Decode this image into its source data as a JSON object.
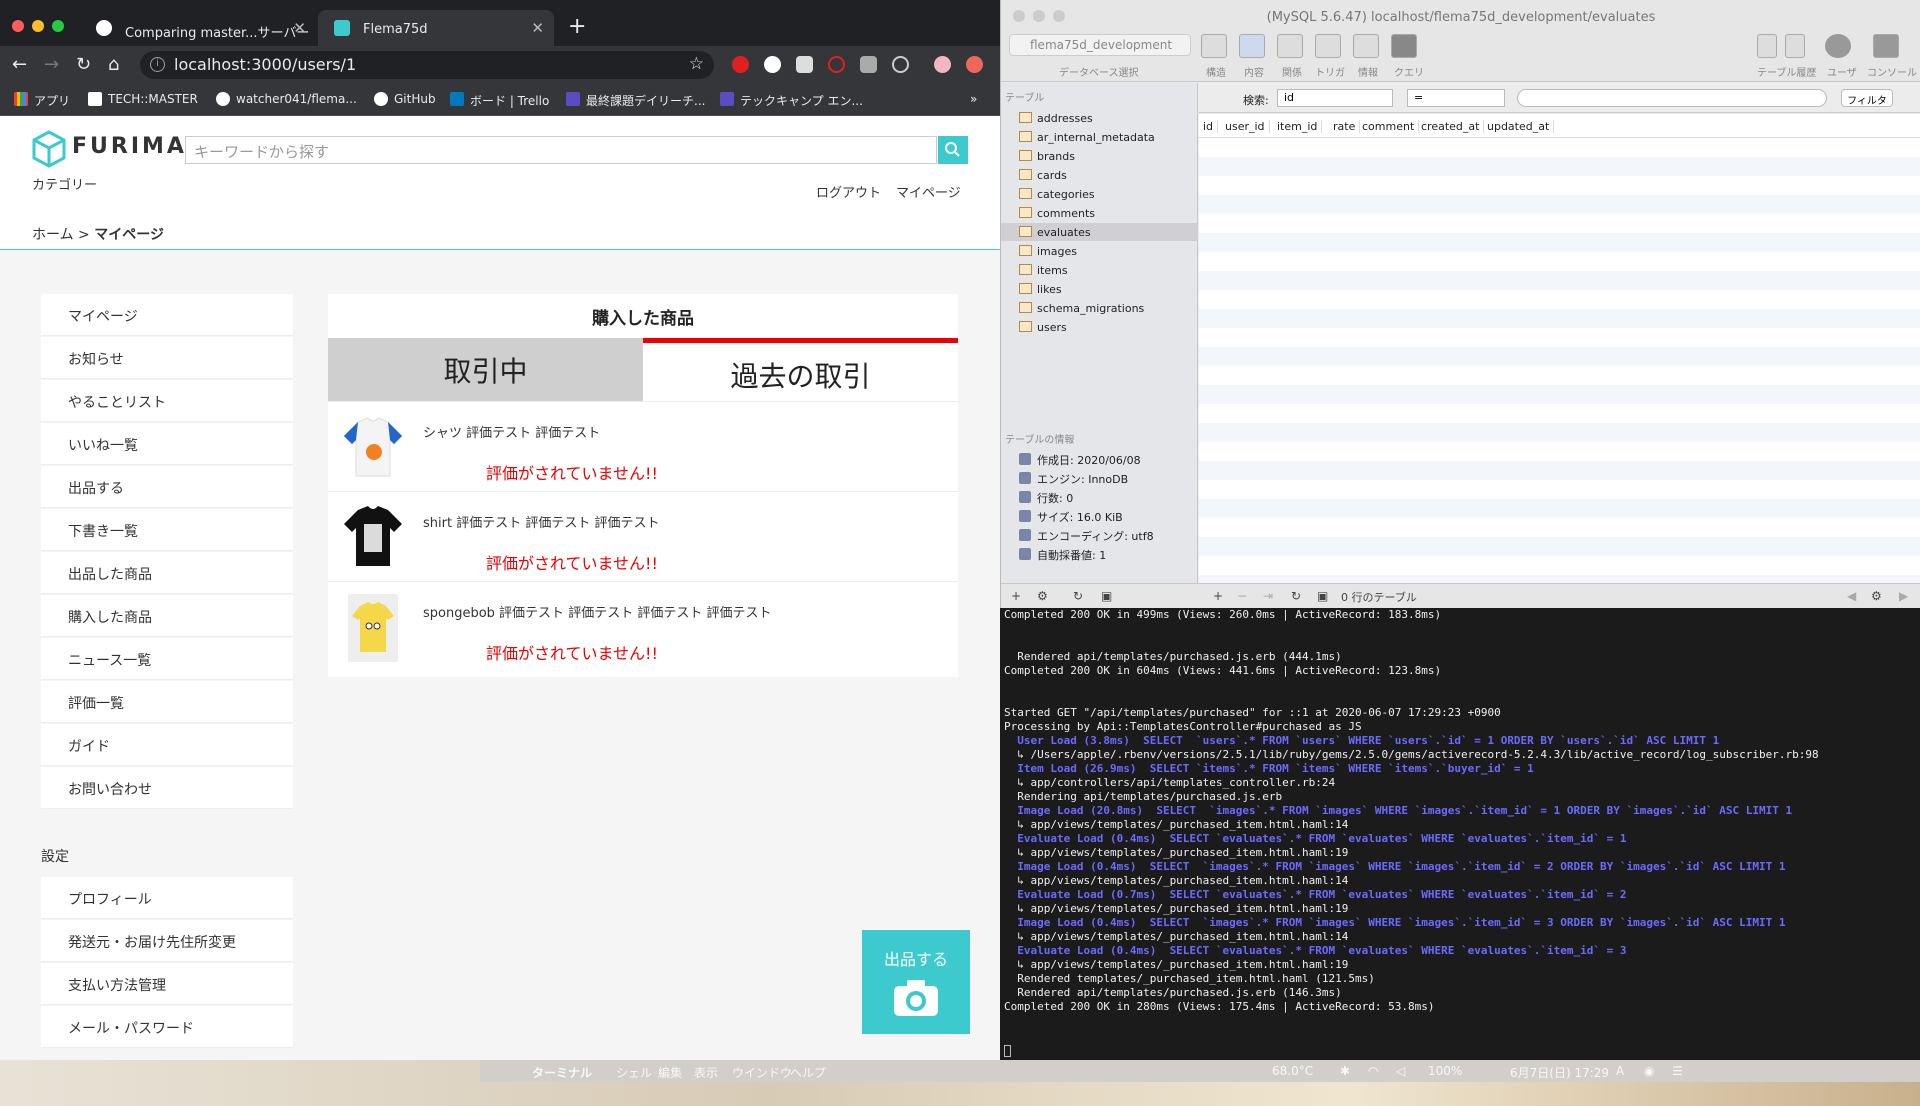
{
  "browser": {
    "tabs": [
      {
        "title": "Comparing master...サーバー"
      },
      {
        "title": "Flema75d"
      }
    ],
    "url": "localhost:3000/users/1",
    "bookmarks": [
      "アプリ",
      "TECH::MASTER",
      "watcher041/flema...",
      "GitHub",
      "ボード | Trello",
      "最終課題デイリーチ...",
      "テックキャンプ エン..."
    ]
  },
  "site": {
    "logo": "FURIMA",
    "search_placeholder": "キーワードから探す",
    "category": "カテゴリー",
    "logout": "ログアウト",
    "mypage": "マイページ",
    "breadcrumb": {
      "home": "ホーム",
      "sep": ">",
      "current": "マイページ"
    },
    "menu": [
      "マイページ",
      "お知らせ",
      "やることリスト",
      "いいね一覧",
      "出品する",
      "下書き一覧",
      "出品した商品",
      "購入した商品",
      "ニュース一覧",
      "評価一覧",
      "ガイド",
      "お問い合わせ"
    ],
    "settings_heading": "設定",
    "settings": [
      "プロフィール",
      "発送元・お届け先住所変更",
      "支払い方法管理",
      "メール・パスワード"
    ],
    "content_title": "購入した商品",
    "tab_in_progress": "取引中",
    "tab_past": "過去の取引",
    "items": [
      {
        "name": "シャツ 評価テスト 評価テスト",
        "status": "評価がされていません!!"
      },
      {
        "name": "shirt 評価テスト 評価テスト 評価テスト",
        "status": "評価がされていません!!"
      },
      {
        "name": "spongebob 評価テスト 評価テスト 評価テスト 評価テスト",
        "status": "評価がされていません!!"
      }
    ],
    "sell_button": "出品する"
  },
  "sequel": {
    "title": "(MySQL 5.6.47) localhost/flema75d_development/evaluates",
    "database": "flema75d_development",
    "database_label": "データベース選択",
    "toolbar": [
      "構造",
      "内容",
      "関係",
      "トリガ",
      "情報",
      "クエリ"
    ],
    "toolbar_right": [
      "テーブル履歴",
      "ユーザ",
      "コンソール"
    ],
    "tables_heading": "テーブル",
    "tables": [
      "addresses",
      "ar_internal_metadata",
      "brands",
      "cards",
      "categories",
      "comments",
      "evaluates",
      "images",
      "items",
      "likes",
      "schema_migrations",
      "users"
    ],
    "selected_table": "evaluates",
    "filter": {
      "label": "検索:",
      "field": "id",
      "op": "=",
      "button": "フィルタ"
    },
    "columns": [
      "id",
      "user_id",
      "item_id",
      "rate",
      "comment",
      "created_at",
      "updated_at"
    ],
    "info_heading": "テーブルの情報",
    "info": [
      "作成日: 2020/06/08",
      "エンジン: InnoDB",
      "行数: 0",
      "サイズ: 16.0 KiB",
      "エンコーディング: utf8",
      "自動採番値: 1"
    ],
    "row_count": "0 行のテーブル"
  },
  "terminal": {
    "lines": [
      {
        "t": "Completed 200 OK in 499ms (Views: 260.0ms | ActiveRecord: 183.8ms)",
        "sql": false
      },
      {
        "t": "",
        "sql": false
      },
      {
        "t": "",
        "sql": false
      },
      {
        "t": "  Rendered api/templates/purchased.js.erb (444.1ms)",
        "sql": false
      },
      {
        "t": "Completed 200 OK in 604ms (Views: 441.6ms | ActiveRecord: 123.8ms)",
        "sql": false
      },
      {
        "t": "",
        "sql": false
      },
      {
        "t": "",
        "sql": false
      },
      {
        "t": "Started GET \"/api/templates/purchased\" for ::1 at 2020-06-07 17:29:23 +0900",
        "sql": false
      },
      {
        "t": "Processing by Api::TemplatesController#purchased as JS",
        "sql": false
      },
      {
        "t": "  User Load (3.8ms)  SELECT  `users`.* FROM `users` WHERE `users`.`id` = 1 ORDER BY `users`.`id` ASC LIMIT 1",
        "sql": true
      },
      {
        "t": "  ↳ /Users/apple/.rbenv/versions/2.5.1/lib/ruby/gems/2.5.0/gems/activerecord-5.2.4.3/lib/active_record/log_subscriber.rb:98",
        "sql": false
      },
      {
        "t": "  Item Load (26.9ms)  SELECT `items`.* FROM `items` WHERE `items`.`buyer_id` = 1",
        "sql": true
      },
      {
        "t": "  ↳ app/controllers/api/templates_controller.rb:24",
        "sql": false
      },
      {
        "t": "  Rendering api/templates/purchased.js.erb",
        "sql": false
      },
      {
        "t": "  Image Load (20.8ms)  SELECT  `images`.* FROM `images` WHERE `images`.`item_id` = 1 ORDER BY `images`.`id` ASC LIMIT 1",
        "sql": true
      },
      {
        "t": "  ↳ app/views/templates/_purchased_item.html.haml:14",
        "sql": false
      },
      {
        "t": "  Evaluate Load (0.4ms)  SELECT `evaluates`.* FROM `evaluates` WHERE `evaluates`.`item_id` = 1",
        "sql": true
      },
      {
        "t": "  ↳ app/views/templates/_purchased_item.html.haml:19",
        "sql": false
      },
      {
        "t": "  Image Load (0.4ms)  SELECT  `images`.* FROM `images` WHERE `images`.`item_id` = 2 ORDER BY `images`.`id` ASC LIMIT 1",
        "sql": true
      },
      {
        "t": "  ↳ app/views/templates/_purchased_item.html.haml:14",
        "sql": false
      },
      {
        "t": "  Evaluate Load (0.7ms)  SELECT `evaluates`.* FROM `evaluates` WHERE `evaluates`.`item_id` = 2",
        "sql": true
      },
      {
        "t": "  ↳ app/views/templates/_purchased_item.html.haml:19",
        "sql": false
      },
      {
        "t": "  Image Load (0.4ms)  SELECT  `images`.* FROM `images` WHERE `images`.`item_id` = 3 ORDER BY `images`.`id` ASC LIMIT 1",
        "sql": true
      },
      {
        "t": "  ↳ app/views/templates/_purchased_item.html.haml:14",
        "sql": false
      },
      {
        "t": "  Evaluate Load (0.4ms)  SELECT `evaluates`.* FROM `evaluates` WHERE `evaluates`.`item_id` = 3",
        "sql": true
      },
      {
        "t": "  ↳ app/views/templates/_purchased_item.html.haml:19",
        "sql": false
      },
      {
        "t": "  Rendered templates/_purchased_item.html.haml (121.5ms)",
        "sql": false
      },
      {
        "t": "  Rendered api/templates/purchased.js.erb (146.3ms)",
        "sql": false
      },
      {
        "t": "Completed 200 OK in 280ms (Views: 175.4ms | ActiveRecord: 53.8ms)",
        "sql": false
      }
    ]
  },
  "menubar": {
    "app": "ターミナル",
    "menus": [
      "シェル",
      "編集",
      "表示",
      "ウインドウ",
      "ヘルプ"
    ],
    "temp": "68.0°C",
    "battery": "100%",
    "clock": "6月7日(日) 17:29"
  }
}
